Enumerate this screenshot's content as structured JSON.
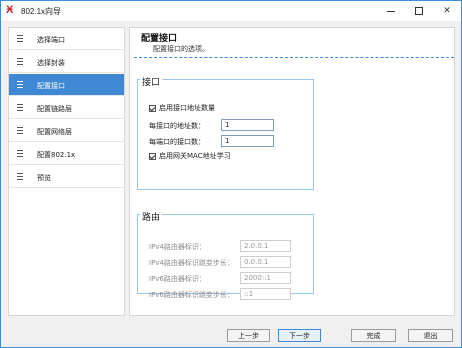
{
  "window": {
    "title": "802.1x向导"
  },
  "sidebar": {
    "items": [
      {
        "label": "选择端口",
        "active": false
      },
      {
        "label": "选择封装",
        "active": false
      },
      {
        "label": "配置接口",
        "active": true
      },
      {
        "label": "配置链路层",
        "active": false
      },
      {
        "label": "配置网络层",
        "active": false
      },
      {
        "label": "配置802.1x",
        "active": false
      },
      {
        "label": "预览",
        "active": false
      }
    ]
  },
  "content": {
    "title": "配置接口",
    "subtitle": "配置接口的选项。",
    "interface_group": {
      "title": "接口",
      "enable_address_count_label": "启用接口地址数量",
      "enable_address_count_checked": true,
      "addresses_per_interface_label": "每接口的地址数：",
      "addresses_per_interface_value": "1",
      "interfaces_per_port_label": "每端口的接口数：",
      "interfaces_per_port_value": "1",
      "enable_gateway_mac_label": "启用网关MAC地址学习",
      "enable_gateway_mac_checked": true
    },
    "routing_group": {
      "title": "路由",
      "ipv4_router_id_label": "IPv4路由器标识：",
      "ipv4_router_id_value": "2.0.0.1",
      "ipv4_router_id_step_label": "IPv4路由器标识跳变步长：",
      "ipv4_router_id_step_value": "0.0.0.1",
      "ipv6_router_id_label": "IPv6路由器标识：",
      "ipv6_router_id_value": "2000::1",
      "ipv6_router_id_step_label": "IPv6路由器标识跳变步长：",
      "ipv6_router_id_step_value": "::1"
    }
  },
  "footer": {
    "prev_label": "上一步",
    "next_label": "下一步",
    "finish_label": "完成",
    "exit_label": "退出"
  }
}
